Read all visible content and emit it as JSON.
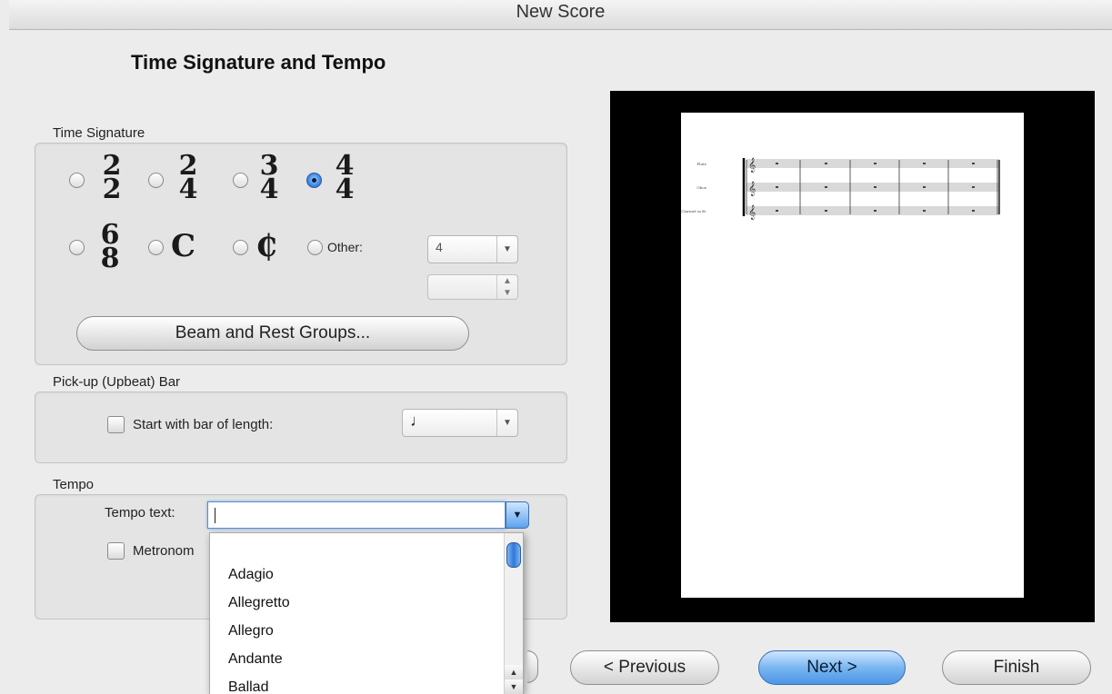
{
  "window": {
    "title": "New Score"
  },
  "page_title": "Time Signature and Tempo",
  "time_signature": {
    "label": "Time Signature",
    "options": [
      {
        "top": "2",
        "bottom": "2",
        "selected": false
      },
      {
        "top": "2",
        "bottom": "4",
        "selected": false
      },
      {
        "top": "3",
        "bottom": "4",
        "selected": false
      },
      {
        "top": "4",
        "bottom": "4",
        "selected": true
      },
      {
        "top": "6",
        "bottom": "8",
        "selected": false
      }
    ],
    "common_time_symbol": "C",
    "cut_time_symbol": "₵",
    "other_label": "Other:",
    "other_numerator": "4",
    "other_denominator": "",
    "beam_button": "Beam and Rest Groups..."
  },
  "pickup": {
    "label": "Pick-up (Upbeat) Bar",
    "checkbox_label": "Start with bar of length:",
    "checked": false,
    "length_symbol": "♩"
  },
  "tempo": {
    "label": "Tempo",
    "text_label": "Tempo text:",
    "text_value": "",
    "metronome_label": "Metronom",
    "metronome_checked": false,
    "dropdown_items": [
      "Adagio",
      "Allegretto",
      "Allegro",
      "Andante",
      "Ballad"
    ]
  },
  "buttons": {
    "previous": "< Previous",
    "next": "Next >",
    "finish": "Finish"
  },
  "preview": {
    "instruments": [
      "Flute",
      "Oboe",
      "Clarinet in B♭"
    ],
    "bars": 5
  },
  "colors": {
    "accent": "#4c95e4",
    "preview_background": "#000000",
    "panel_background": "#ececec"
  }
}
